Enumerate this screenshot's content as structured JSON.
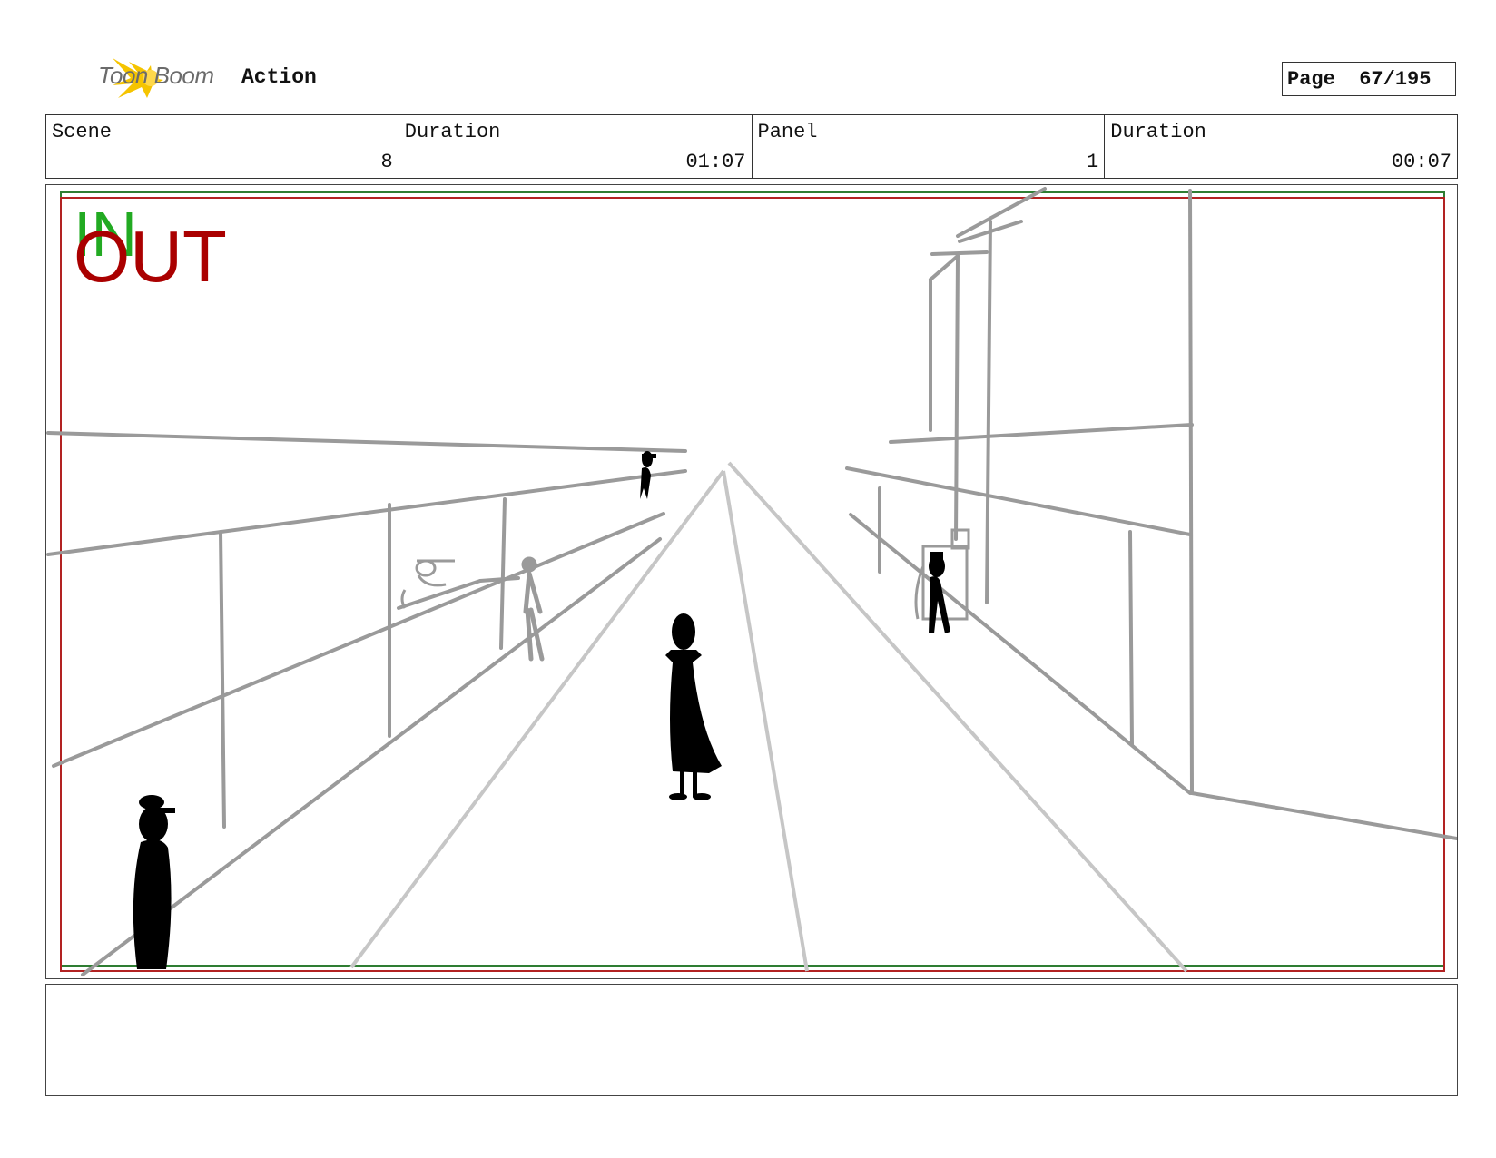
{
  "header": {
    "brand_name": "Toon Boom",
    "brand_icon": "toon-boom-star-icon",
    "brand_color": "#f5c400",
    "title": "Action",
    "page_label": "Page",
    "page_number": "67/195"
  },
  "info": {
    "scene_label": "Scene",
    "scene_value": "8",
    "scene_duration_label": "Duration",
    "scene_duration_value": "01:07",
    "panel_label": "Panel",
    "panel_value": "1",
    "panel_duration_label": "Duration",
    "panel_duration_value": "00:07"
  },
  "panel": {
    "in_label": "IN",
    "out_label": "OUT",
    "in_color": "#22aa22",
    "out_color": "#aa0000",
    "safe_frame_color": "#b22222",
    "title_safe_color": "#2e7d32"
  },
  "notes": {
    "text": ""
  }
}
